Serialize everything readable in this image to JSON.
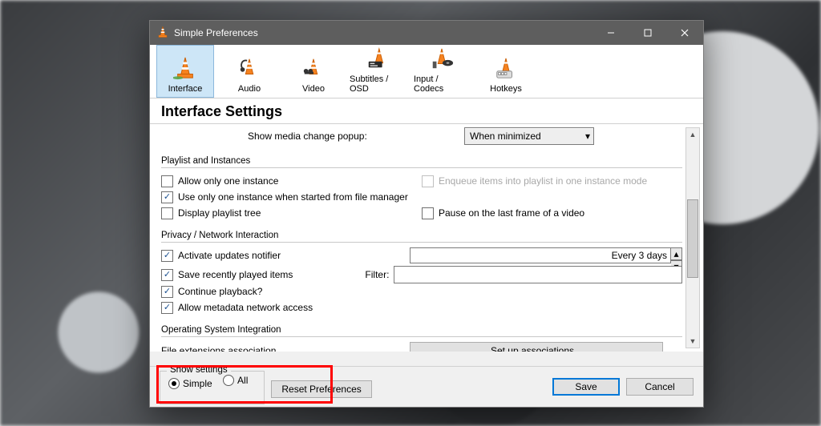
{
  "titlebar": {
    "title": "Simple Preferences"
  },
  "tabs": [
    "Interface",
    "Audio",
    "Video",
    "Subtitles / OSD",
    "Input / Codecs",
    "Hotkeys"
  ],
  "heading": "Interface Settings",
  "popup": {
    "label": "Show media change popup:",
    "value": "When minimized"
  },
  "group1": {
    "title": "Playlist and Instances",
    "allow_one": "Allow only one instance",
    "use_one_fm": "Use only one instance when started from file manager",
    "display_tree": "Display playlist tree",
    "enqueue": "Enqueue items into playlist in one instance mode",
    "pause_last": "Pause on the last frame of a video"
  },
  "group2": {
    "title": "Privacy / Network Interaction",
    "activate_updates": "Activate updates notifier",
    "update_interval": "Every 3 days",
    "save_recent": "Save recently played items",
    "filter_label": "Filter:",
    "continue_playback": "Continue playback?",
    "allow_metadata": "Allow metadata network access"
  },
  "group3": {
    "title": "Operating System Integration",
    "file_ext": "File extensions association",
    "setup_btn": "Set up associations..."
  },
  "footer": {
    "legend": "Show settings",
    "simple": "Simple",
    "all": "All",
    "reset": "Reset Preferences",
    "save": "Save",
    "cancel": "Cancel"
  }
}
